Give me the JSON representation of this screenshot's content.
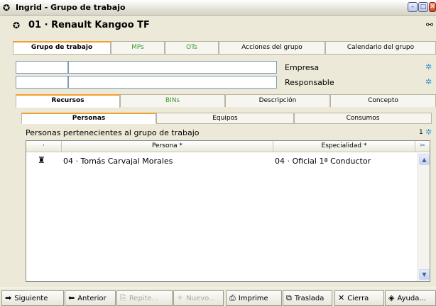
{
  "window": {
    "title": "Ingrid - Grupo de trabajo",
    "app_icon": "app-icon",
    "controls": [
      "minimize",
      "maximize",
      "close"
    ]
  },
  "header": {
    "title": "01 · Renault Kangoo TF",
    "icon": "group-icon",
    "binoculars": "binoculars-icon"
  },
  "top_tabs": [
    {
      "label": "Grupo de trabajo",
      "active": true
    },
    {
      "label": "MPs",
      "active": false,
      "color": "#3a9a30"
    },
    {
      "label": "OTs",
      "active": false,
      "color": "#3a9a30"
    },
    {
      "label": "Acciones del grupo",
      "active": false
    },
    {
      "label": "Calendario del grupo",
      "active": false
    }
  ],
  "fields": {
    "empresa": {
      "label": "Empresa",
      "code": "",
      "value": ""
    },
    "responsable": {
      "label": "Responsable",
      "code": "",
      "value": ""
    }
  },
  "mid_tabs": [
    {
      "label": "Recursos",
      "active": true
    },
    {
      "label": "BINs",
      "active": false,
      "color": "#3a9a30"
    },
    {
      "label": "Descripción",
      "active": false
    },
    {
      "label": "Concepto",
      "active": false
    }
  ],
  "sub_tabs": [
    {
      "label": "Personas",
      "active": true
    },
    {
      "label": "Equipos",
      "active": false
    },
    {
      "label": "Consumos",
      "active": false
    }
  ],
  "list": {
    "caption": "Personas pertenecientes al grupo de trabajo",
    "count": "1",
    "columns": [
      "·",
      "Persona *",
      "Especialidad *"
    ],
    "rows": [
      {
        "persona": "04 · Tomás Carvajal Morales",
        "especialidad": "04 · Oficial 1ª Conductor"
      }
    ]
  },
  "bottom_buttons": [
    {
      "label": "Siguiente",
      "icon": "arrow-right-icon",
      "enabled": true
    },
    {
      "label": "Anterior",
      "icon": "arrow-left-icon",
      "enabled": true
    },
    {
      "label": "Repite...",
      "icon": "repeat-icon",
      "enabled": false
    },
    {
      "label": "Nuevo...",
      "icon": "new-icon",
      "enabled": false
    },
    {
      "label": "Imprime",
      "icon": "printer-icon",
      "enabled": true
    },
    {
      "label": "Traslada",
      "icon": "move-icon",
      "enabled": true
    },
    {
      "label": "Cierra",
      "icon": "close-x-icon",
      "enabled": true
    },
    {
      "label": "Ayuda...",
      "icon": "help-book-icon",
      "enabled": true
    }
  ]
}
